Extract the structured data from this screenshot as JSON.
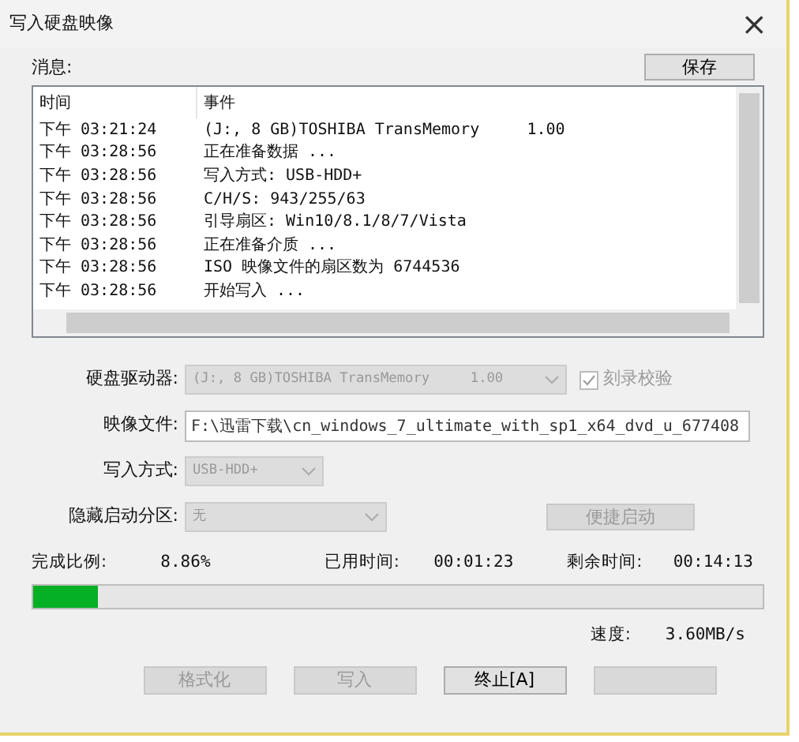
{
  "window": {
    "title": "写入硬盘映像",
    "close": "×"
  },
  "messages": {
    "label": "消息:",
    "save_button": "保存",
    "columns": [
      "时间",
      "事件"
    ],
    "rows": [
      {
        "time": "下午 03:21:24",
        "event": "(J:, 8 GB)TOSHIBA TransMemory     1.00"
      },
      {
        "time": "下午 03:28:56",
        "event": "正在准备数据 ..."
      },
      {
        "time": "下午 03:28:56",
        "event": "写入方式: USB-HDD+"
      },
      {
        "time": "下午 03:28:56",
        "event": "C/H/S: 943/255/63"
      },
      {
        "time": "下午 03:28:56",
        "event": "引导扇区: Win10/8.1/8/7/Vista"
      },
      {
        "time": "下午 03:28:56",
        "event": "正在准备介质 ..."
      },
      {
        "time": "下午 03:28:56",
        "event": "ISO 映像文件的扇区数为 6744536"
      },
      {
        "time": "下午 03:28:56",
        "event": "开始写入 ..."
      }
    ]
  },
  "form": [
    {
      "kind": "select",
      "label": "硬盘驱动器:",
      "value": "(J:, 8 GB)TOSHIBA TransMemory     1.00",
      "disabled": true,
      "checkbox": {
        "label": "刻录校验",
        "checked": true,
        "disabled": true
      }
    },
    {
      "kind": "text",
      "label": "映像文件:",
      "value": "F:\\迅雷下载\\cn_windows_7_ultimate_with_sp1_x64_dvd_u_677408",
      "disabled": false
    },
    {
      "kind": "select",
      "label": "写入方式:",
      "value": "USB-HDD+",
      "disabled": true
    },
    {
      "kind": "select",
      "label": "隐藏启动分区:",
      "value": "无",
      "disabled": true,
      "button": {
        "label": "便捷启动",
        "disabled": true
      }
    }
  ],
  "progress": {
    "done_label": "完成比例:",
    "done_value": "8.86%",
    "elapsed_label": "已用时间:",
    "elapsed_value": "00:01:23",
    "remaining_label": "剩余时间:",
    "remaining_value": "00:14:13",
    "level": 0.0886,
    "speed_label": "速度:",
    "speed_value": "3.60MB/s"
  },
  "buttons": [
    {
      "label": "格式化",
      "disabled": true
    },
    {
      "label": "写入",
      "disabled": true
    },
    {
      "label": "终止[A]",
      "disabled": false
    },
    {
      "disabled": true
    }
  ]
}
